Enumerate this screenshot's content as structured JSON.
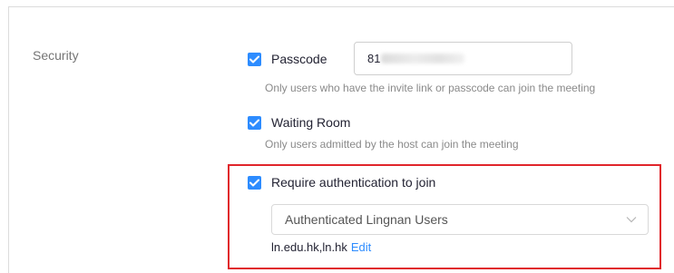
{
  "section": {
    "label": "Security"
  },
  "passcode": {
    "label": "Passcode",
    "value_visible": "81",
    "hint": "Only users who have the invite link or passcode can join the meeting"
  },
  "waiting_room": {
    "label": "Waiting Room",
    "hint": "Only users admitted by the host can join the meeting"
  },
  "authentication": {
    "label": "Require authentication to join",
    "selected_option": "Authenticated Lingnan Users",
    "domains": "ln.edu.hk,ln.hk",
    "edit_label": "Edit"
  },
  "colors": {
    "accent": "#2d8cff",
    "highlight_border": "#e0252b"
  },
  "icons": {
    "checkbox": "checkmark-icon",
    "dropdown": "chevron-down-icon"
  }
}
